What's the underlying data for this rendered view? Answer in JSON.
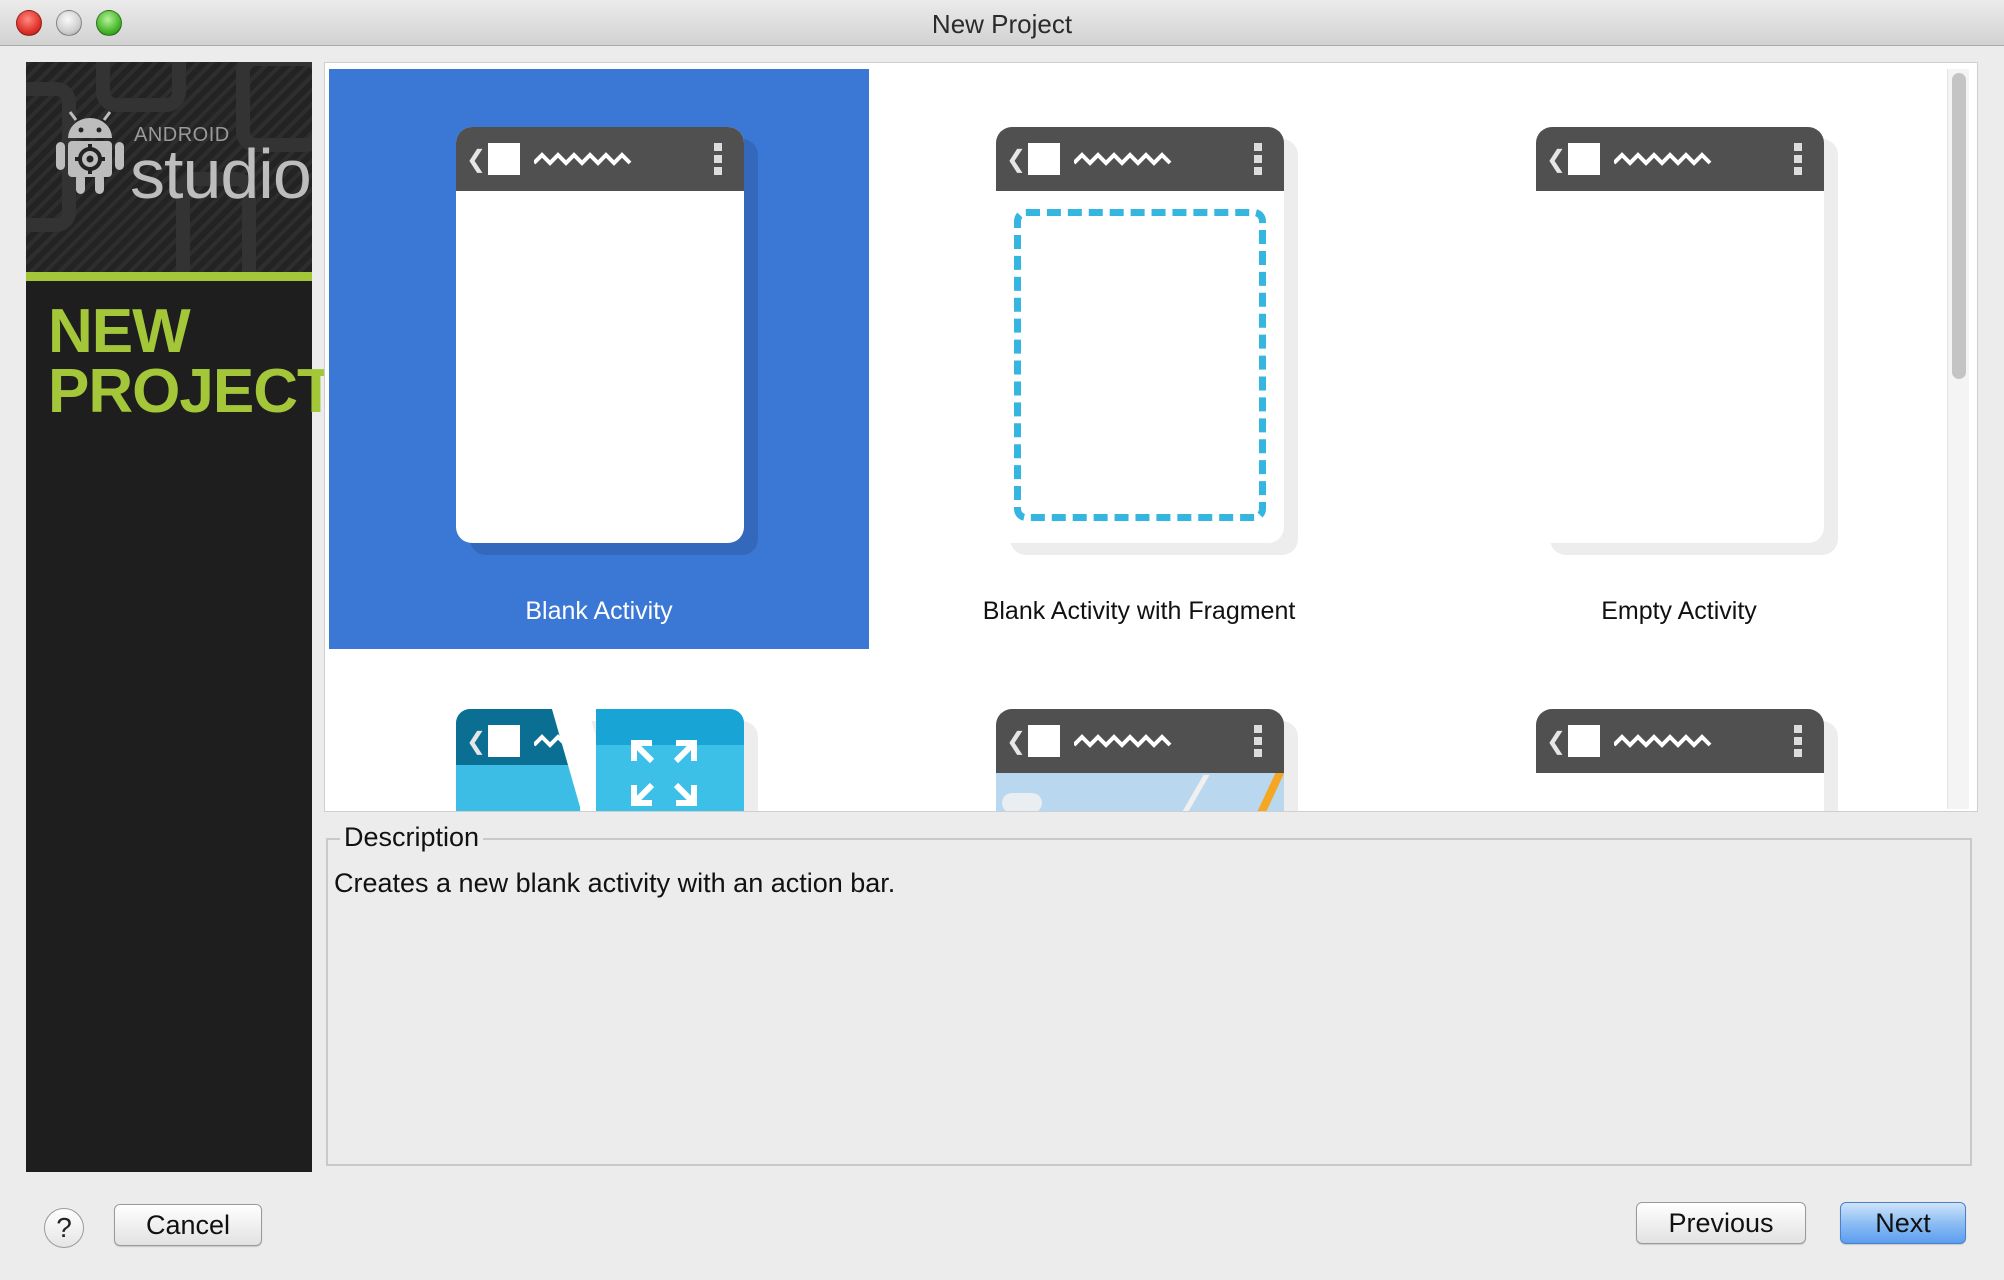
{
  "window": {
    "title": "New Project"
  },
  "brand": {
    "android_label": "ANDROID",
    "studio_label": "studio",
    "heading_line1": "NEW",
    "heading_line2": "PROJECT",
    "accent_color": "#a4c639"
  },
  "gallery": {
    "selected_index": 0,
    "templates": [
      {
        "label": "Blank Activity",
        "icon": "blank-activity-thumbnail"
      },
      {
        "label": "Blank Activity with Fragment",
        "icon": "blank-fragment-thumbnail"
      },
      {
        "label": "Empty Activity",
        "icon": "empty-activity-thumbnail"
      },
      {
        "label": "",
        "icon": "fullscreen-activity-thumbnail"
      },
      {
        "label": "",
        "icon": "map-activity-thumbnail"
      },
      {
        "label": "",
        "icon": "activity-thumbnail"
      }
    ],
    "selection_color": "#3b77d4"
  },
  "description": {
    "legend": "Description",
    "text": "Creates a new blank activity with an action bar."
  },
  "buttons": {
    "help": "?",
    "cancel": "Cancel",
    "previous": "Previous",
    "next": "Next"
  }
}
